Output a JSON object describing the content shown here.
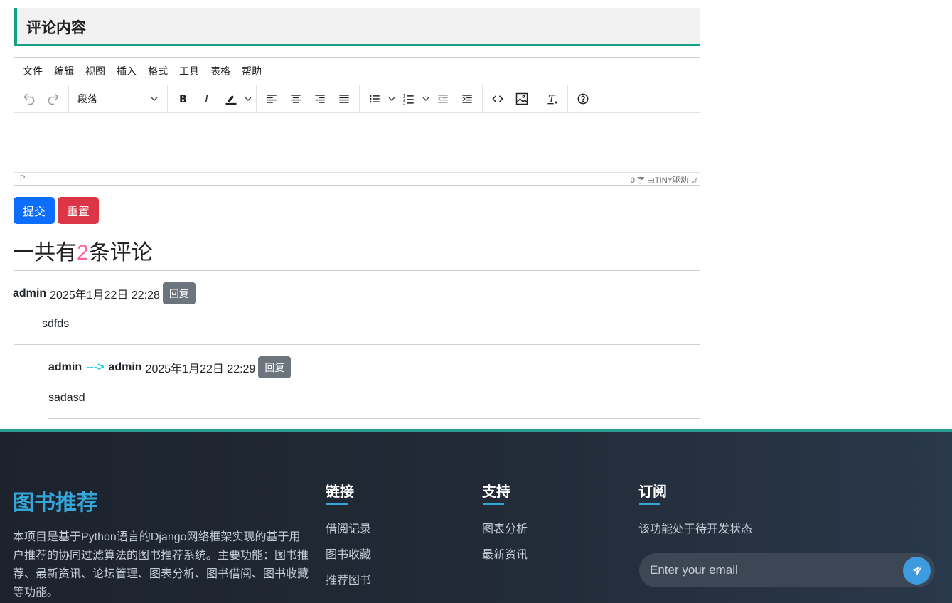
{
  "section": {
    "title": "评论内容"
  },
  "editor": {
    "menu": [
      "文件",
      "编辑",
      "视图",
      "插入",
      "格式",
      "工具",
      "表格",
      "帮助"
    ],
    "block_format": "段落",
    "status_path": "P",
    "status_right": "0 字  由TINY驱动"
  },
  "buttons": {
    "submit": "提交",
    "reset": "重置"
  },
  "count": {
    "prefix": "一共有",
    "number": "2",
    "suffix": "条评论"
  },
  "comments": [
    {
      "user": "admin",
      "date": "2025年1月22日 22:28",
      "reply": "回复",
      "body": "sdfds"
    },
    {
      "user": "admin",
      "arrow": "--->",
      "target": "admin",
      "date": "2025年1月22日 22:29",
      "reply": "回复",
      "body": "sadasd"
    }
  ],
  "footer": {
    "brand": "图书推荐",
    "description": "本项目是基于Python语言的Django网络框架实现的基于用户推荐的协同过滤算法的图书推荐系统。主要功能：图书推荐、最新资讯、论坛管理、图表分析、图书借阅、图书收藏等功能。",
    "links": {
      "title": "链接",
      "items": [
        "借阅记录",
        "图书收藏",
        "推荐图书"
      ]
    },
    "support": {
      "title": "支持",
      "items": [
        "图表分析",
        "最新资讯"
      ]
    },
    "subscribe": {
      "title": "订阅",
      "text": "该功能处于待开发状态",
      "placeholder": "Enter your email"
    }
  },
  "colors": {
    "accent_green": "#17a083",
    "primary": "#0d6efd",
    "danger": "#dc3545",
    "count_pink": "#ff5fa2",
    "brand_blue": "#34a6d8"
  }
}
